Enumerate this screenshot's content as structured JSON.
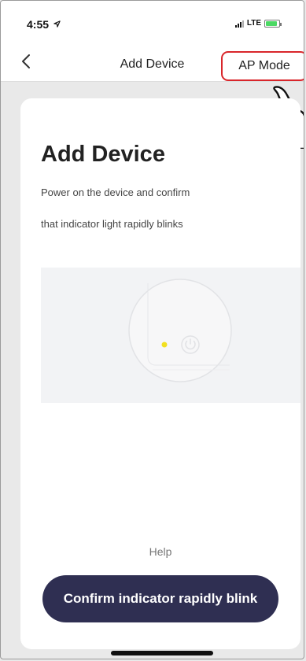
{
  "status_bar": {
    "time": "4:55",
    "network": "LTE"
  },
  "nav": {
    "title": "Add Device",
    "ap_mode_label": "AP Mode"
  },
  "card": {
    "title": "Add Device",
    "desc_line1": "Power on the device and confirm",
    "desc_line2": "that indicator light rapidly blinks",
    "help_label": "Help",
    "confirm_label": "Confirm indicator rapidly blink"
  },
  "colors": {
    "highlight": "#d9262b",
    "button_bg": "#2f2f52",
    "indicator_light": "#f2e020"
  },
  "icons": [
    "location-arrow-icon",
    "signal-icon",
    "battery-icon",
    "back-chevron-icon",
    "hand-pointer-icon",
    "power-icon"
  ]
}
